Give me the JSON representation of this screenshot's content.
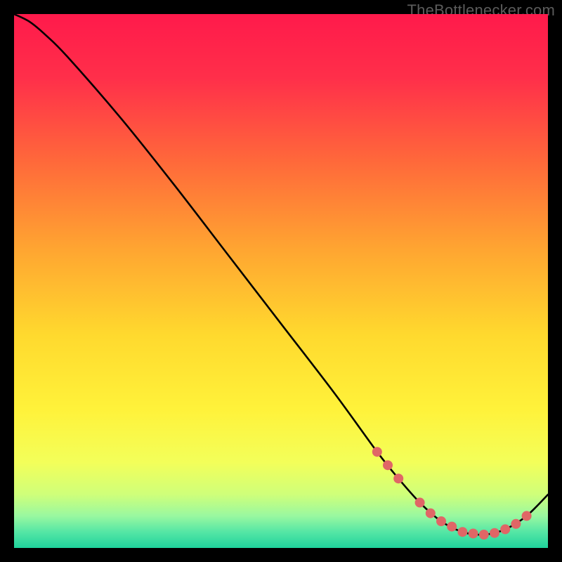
{
  "attribution": "TheBottlenecker.com",
  "chart_data": {
    "type": "line",
    "title": "",
    "xlabel": "",
    "ylabel": "",
    "xlim": [
      0,
      100
    ],
    "ylim": [
      0,
      100
    ],
    "series": [
      {
        "name": "curve",
        "x": [
          0,
          3,
          6,
          10,
          20,
          30,
          40,
          50,
          60,
          68,
          72,
          76,
          80,
          84,
          88,
          92,
          96,
          100
        ],
        "y": [
          100,
          98.5,
          96,
          92,
          80.5,
          68,
          55,
          42,
          29,
          18,
          13,
          8.5,
          5,
          3,
          2.5,
          3.5,
          6,
          10
        ]
      }
    ],
    "markers": {
      "name": "highlight-dots",
      "color": "#e06666",
      "x": [
        68,
        70,
        72,
        76,
        78,
        80,
        82,
        84,
        86,
        88,
        90,
        92,
        94,
        96
      ],
      "y": [
        18,
        15.5,
        13,
        8.5,
        6.5,
        5,
        4,
        3,
        2.7,
        2.5,
        2.8,
        3.5,
        4.5,
        6
      ]
    },
    "background_gradient": {
      "stops": [
        {
          "offset": 0.0,
          "color": "#ff1a4b"
        },
        {
          "offset": 0.12,
          "color": "#ff2f4a"
        },
        {
          "offset": 0.28,
          "color": "#ff6a3a"
        },
        {
          "offset": 0.44,
          "color": "#ffa531"
        },
        {
          "offset": 0.6,
          "color": "#ffd92e"
        },
        {
          "offset": 0.74,
          "color": "#fff23a"
        },
        {
          "offset": 0.84,
          "color": "#f3ff5a"
        },
        {
          "offset": 0.9,
          "color": "#cfff7a"
        },
        {
          "offset": 0.94,
          "color": "#99f8a0"
        },
        {
          "offset": 0.97,
          "color": "#55e6a5"
        },
        {
          "offset": 1.0,
          "color": "#1fd39c"
        }
      ]
    }
  }
}
